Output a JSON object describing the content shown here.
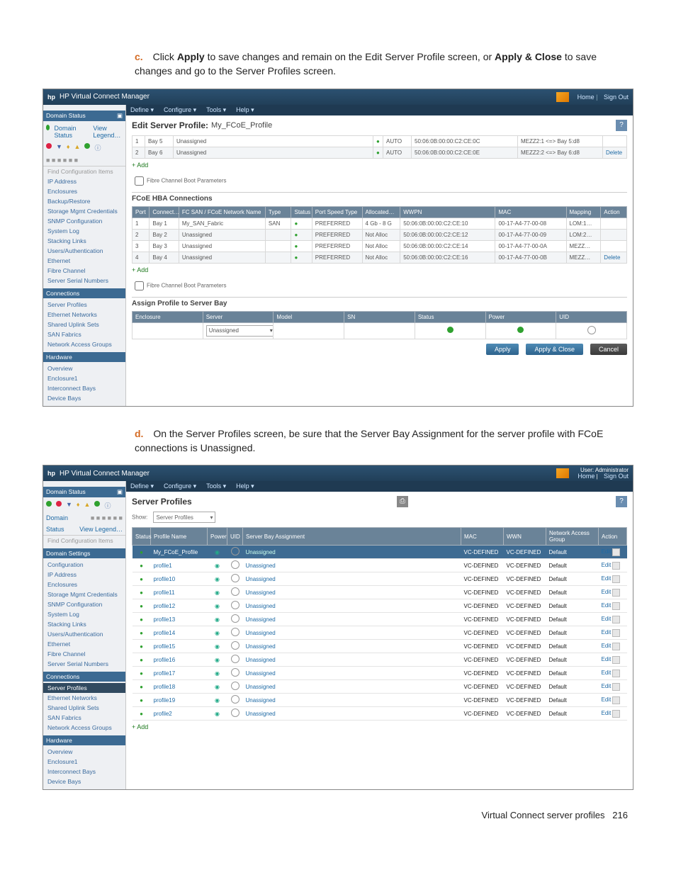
{
  "instr_c_letter": "c.",
  "instr_c_pre": "Click ",
  "instr_c_b1": "Apply",
  "instr_c_mid": " to save changes and remain on the Edit Server Profile screen, or ",
  "instr_c_b2": "Apply & Close",
  "instr_c_post": " to save changes and go to the Server Profiles screen.",
  "instr_d_letter": "d.",
  "instr_d_text": "On the Server Profiles screen, be sure that the Server Bay Assignment for the server profile with FCoE connections is Unassigned.",
  "footer_label": "Virtual Connect server profiles",
  "footer_page": "216",
  "shot1": {
    "app_title": "HP Virtual Connect Manager",
    "top_links": [
      "Home",
      "Sign Out"
    ],
    "menus": [
      "Define ▾",
      "Configure ▾",
      "Tools ▾",
      "Help ▾"
    ],
    "side_hdr_domain": "Domain Status",
    "side_links": [
      "Domain Status",
      "View Legend…"
    ],
    "side_items_top": [
      "IP Address",
      "Enclosures",
      "Backup/Restore",
      "Storage Mgmt Credentials",
      "SNMP Configuration",
      "System Log",
      "Stacking Links"
    ],
    "side_items_a": [
      "Users/Authentication"
    ],
    "side_items_b": [
      "Ethernet",
      "Fibre Channel",
      "Server Serial Numbers"
    ],
    "side_hdr_conn": "Connections",
    "side_items_c": [
      "Server Profiles",
      "Ethernet Networks",
      "Shared Uplink Sets",
      "SAN Fabrics",
      "Network Access Groups"
    ],
    "side_hdr_hw": "Hardware",
    "side_items_d": [
      "Overview",
      "Enclosure1",
      "Interconnect Bays",
      "Device Bays"
    ],
    "find_placeholder": "Find Configuration Items",
    "title_prefix": "Edit Server Profile:",
    "profile_name": "My_FCoE_Profile",
    "eth_rows": [
      {
        "n": "1",
        "bay": "Bay 5",
        "net": "Unassigned",
        "auto": "AUTO",
        "mac": "50:06:0B:00:00:C2:CE:0C",
        "map": "MEZZ2:1 <=> Bay 5:d8"
      },
      {
        "n": "2",
        "bay": "Bay 6",
        "net": "Unassigned",
        "auto": "AUTO",
        "mac": "50:06:0B:00:00:C2:CE:0E",
        "map": "MEZZ2:2 <=> Bay 6:d8",
        "del": "Delete"
      }
    ],
    "add": "+ Add",
    "fc_boot_label": "Fibre Channel Boot Parameters",
    "fcoe_section": "FCoE HBA Connections",
    "fcoe_hdr": [
      "Port",
      "Connect…",
      "FC SAN / FCoE Network Name",
      "Type",
      "Status",
      "Port Speed Type",
      "Allocated…",
      "WWPN",
      "MAC",
      "Mapping",
      "Action"
    ],
    "fcoe_rows": [
      {
        "n": "1",
        "bay": "Bay 1",
        "name": "My_SAN_Fabric",
        "type": "SAN",
        "spd": "PREFERRED",
        "alloc": "4 Gb - 8 G",
        "wwpn": "50:06:0B:00:00:C2:CE:10",
        "mac": "00-17-A4-77-00-08",
        "map": "LOM:1…"
      },
      {
        "n": "2",
        "bay": "Bay 2",
        "name": "Unassigned",
        "type": "",
        "spd": "PREFERRED",
        "alloc": "Not Alloc",
        "wwpn": "50:06:0B:00:00:C2:CE:12",
        "mac": "00-17-A4-77-00-09",
        "map": "LOM:2…"
      },
      {
        "n": "3",
        "bay": "Bay 3",
        "name": "Unassigned",
        "type": "",
        "spd": "PREFERRED",
        "alloc": "Not Alloc",
        "wwpn": "50:06:0B:00:00:C2:CE:14",
        "mac": "00-17-A4-77-00-0A",
        "map": "MEZZ…"
      },
      {
        "n": "4",
        "bay": "Bay 4",
        "name": "Unassigned",
        "type": "",
        "spd": "PREFERRED",
        "alloc": "Not Alloc",
        "wwpn": "50:06:0B:00:00:C2:CE:16",
        "mac": "00-17-A4-77-00-0B",
        "map": "MEZZ…",
        "del": "Delete"
      }
    ],
    "assign_section": "Assign Profile to Server Bay",
    "assign_hdr": [
      "Enclosure",
      "Server",
      "Model",
      "SN",
      "Status",
      "Power",
      "UID"
    ],
    "assign_value": "Unassigned",
    "btn_apply": "Apply",
    "btn_apply_close": "Apply & Close",
    "btn_cancel": "Cancel"
  },
  "shot2": {
    "app_title": "HP Virtual Connect Manager",
    "user_role": "User: Administrator",
    "top_links": [
      "Home",
      "Sign Out"
    ],
    "menus": [
      "Define ▾",
      "Configure ▾",
      "Tools ▾",
      "Help ▾"
    ],
    "side_hdr_domain": "Domain Status",
    "legend": [
      "Domain",
      "Status",
      "View Legend…"
    ],
    "find_placeholder": "Find Configuration Items",
    "side_hdr_settings": "Domain Settings",
    "side_a": [
      "Configuration",
      "IP Address",
      "Enclosures",
      "Storage Mgmt Credentials",
      "SNMP Configuration",
      "System Log",
      "Stacking Links"
    ],
    "side_b": [
      "Users/Authentication"
    ],
    "side_c": [
      "Ethernet",
      "Fibre Channel",
      "Server Serial Numbers"
    ],
    "side_hdr_conn": "Connections",
    "side_d": [
      "Server Profiles",
      "Ethernet Networks",
      "Shared Uplink Sets",
      "SAN Fabrics",
      "Network Access Groups"
    ],
    "side_hdr_hw": "Hardware",
    "side_e": [
      "Overview",
      "Enclosure1",
      "Interconnect Bays",
      "Device Bays"
    ],
    "title": "Server Profiles",
    "show_label": "Show:",
    "show_value": "Server Profiles",
    "cols": [
      "Status",
      "Profile Name",
      "Power",
      "UID",
      "Server Bay Assignment",
      "MAC",
      "WWN",
      "Network Access Group",
      "Action"
    ],
    "rows": [
      {
        "name": "My_FCoE_Profile",
        "assign": "Unassigned",
        "mac": "VC-DEFINED",
        "wwn": "VC-DEFINED",
        "nag": "Default",
        "edit": "Edit",
        "sel": true
      },
      {
        "name": "profile1",
        "assign": "Unassigned",
        "mac": "VC-DEFINED",
        "wwn": "VC-DEFINED",
        "nag": "Default",
        "edit": "Edit"
      },
      {
        "name": "profile10",
        "assign": "Unassigned",
        "mac": "VC-DEFINED",
        "wwn": "VC-DEFINED",
        "nag": "Default",
        "edit": "Edit"
      },
      {
        "name": "profile11",
        "assign": "Unassigned",
        "mac": "VC-DEFINED",
        "wwn": "VC-DEFINED",
        "nag": "Default",
        "edit": "Edit"
      },
      {
        "name": "profile12",
        "assign": "Unassigned",
        "mac": "VC-DEFINED",
        "wwn": "VC-DEFINED",
        "nag": "Default",
        "edit": "Edit"
      },
      {
        "name": "profile13",
        "assign": "Unassigned",
        "mac": "VC-DEFINED",
        "wwn": "VC-DEFINED",
        "nag": "Default",
        "edit": "Edit"
      },
      {
        "name": "profile14",
        "assign": "Unassigned",
        "mac": "VC-DEFINED",
        "wwn": "VC-DEFINED",
        "nag": "Default",
        "edit": "Edit"
      },
      {
        "name": "profile15",
        "assign": "Unassigned",
        "mac": "VC-DEFINED",
        "wwn": "VC-DEFINED",
        "nag": "Default",
        "edit": "Edit"
      },
      {
        "name": "profile16",
        "assign": "Unassigned",
        "mac": "VC-DEFINED",
        "wwn": "VC-DEFINED",
        "nag": "Default",
        "edit": "Edit"
      },
      {
        "name": "profile17",
        "assign": "Unassigned",
        "mac": "VC-DEFINED",
        "wwn": "VC-DEFINED",
        "nag": "Default",
        "edit": "Edit"
      },
      {
        "name": "profile18",
        "assign": "Unassigned",
        "mac": "VC-DEFINED",
        "wwn": "VC-DEFINED",
        "nag": "Default",
        "edit": "Edit"
      },
      {
        "name": "profile19",
        "assign": "Unassigned",
        "mac": "VC-DEFINED",
        "wwn": "VC-DEFINED",
        "nag": "Default",
        "edit": "Edit"
      },
      {
        "name": "profile2",
        "assign": "Unassigned",
        "mac": "VC-DEFINED",
        "wwn": "VC-DEFINED",
        "nag": "Default",
        "edit": "Edit"
      }
    ],
    "add": "+ Add"
  }
}
